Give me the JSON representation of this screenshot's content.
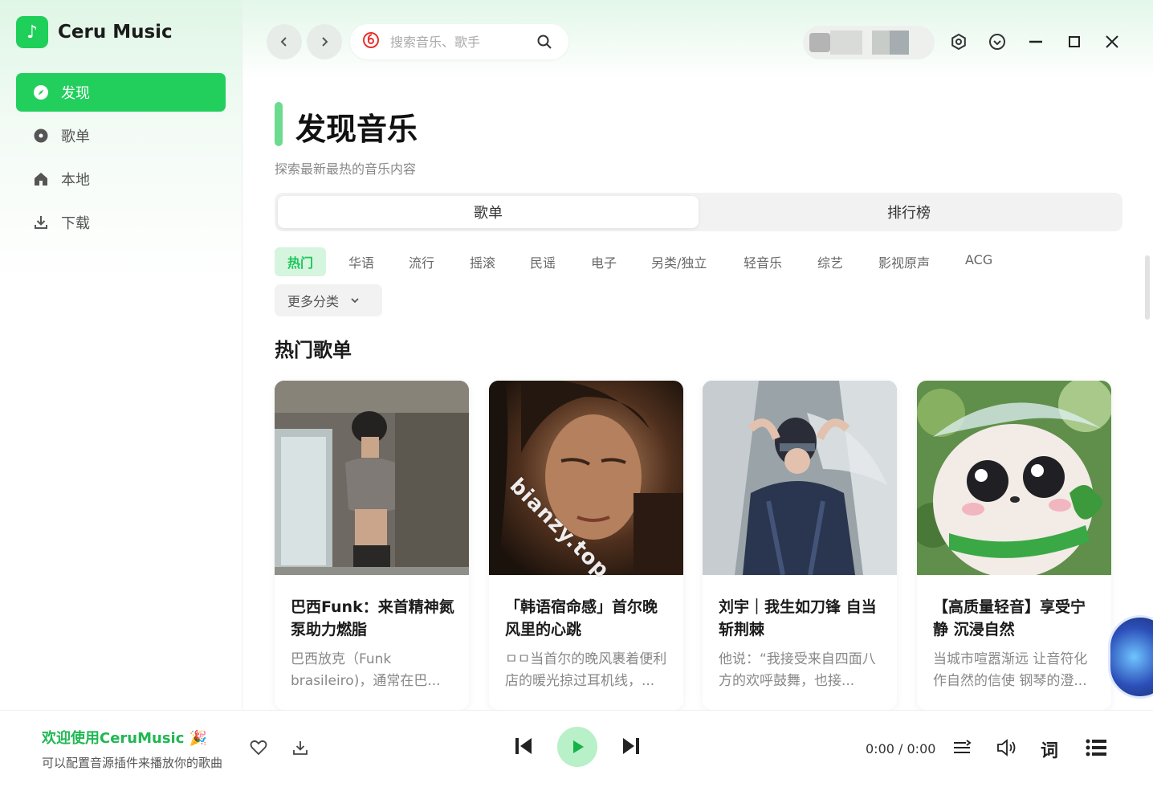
{
  "app": {
    "name": "Ceru Music"
  },
  "sidebar": {
    "items": [
      {
        "label": "发现",
        "icon": "compass-icon",
        "active": true
      },
      {
        "label": "歌单",
        "icon": "disc-icon",
        "active": false
      },
      {
        "label": "本地",
        "icon": "home-icon",
        "active": false
      },
      {
        "label": "下载",
        "icon": "download-icon",
        "active": false
      }
    ]
  },
  "topbar": {
    "search_placeholder": "搜索音乐、歌手"
  },
  "main": {
    "title": "发现音乐",
    "subtitle": "探索最新最热的音乐内容",
    "tabs": [
      {
        "label": "歌单",
        "active": true
      },
      {
        "label": "排行榜",
        "active": false
      }
    ],
    "categories": [
      "热门",
      "华语",
      "流行",
      "摇滚",
      "民谣",
      "电子",
      "另类/独立",
      "轻音乐",
      "综艺",
      "影视原声",
      "ACG"
    ],
    "more_categories": "更多分类",
    "section_title": "热门歌单",
    "playlists": [
      {
        "title": "巴西Funk：来首精神氮泵助力燃脂",
        "desc": "巴西放克（Funk brasileiro)，通常在巴..."
      },
      {
        "title": "「韩语宿命感」首尔晚风里的心跳",
        "desc": "ㅁㅁ当首尔的晚风裹着便利店的暖光掠过耳机线，..."
      },
      {
        "title": "刘宇｜我生如刀锋 自当斩荆棘",
        "desc": "他说：“我接受来自四面八方的欢呼鼓舞，也接..."
      },
      {
        "title": "【高质量轻音】享受宁静 沉浸自然",
        "desc": "当城市喧嚣渐远 让音符化作自然的信使 钢琴的澄..."
      }
    ],
    "watermark": "bianzy.top"
  },
  "player": {
    "welcome": "欢迎使用CeruMusic 🎉",
    "subtext": "可以配置音源插件来播放你的歌曲",
    "time": "0:00 / 0:00"
  },
  "colors": {
    "accent": "#22cf5d",
    "accent_light": "#b8f0c8"
  }
}
